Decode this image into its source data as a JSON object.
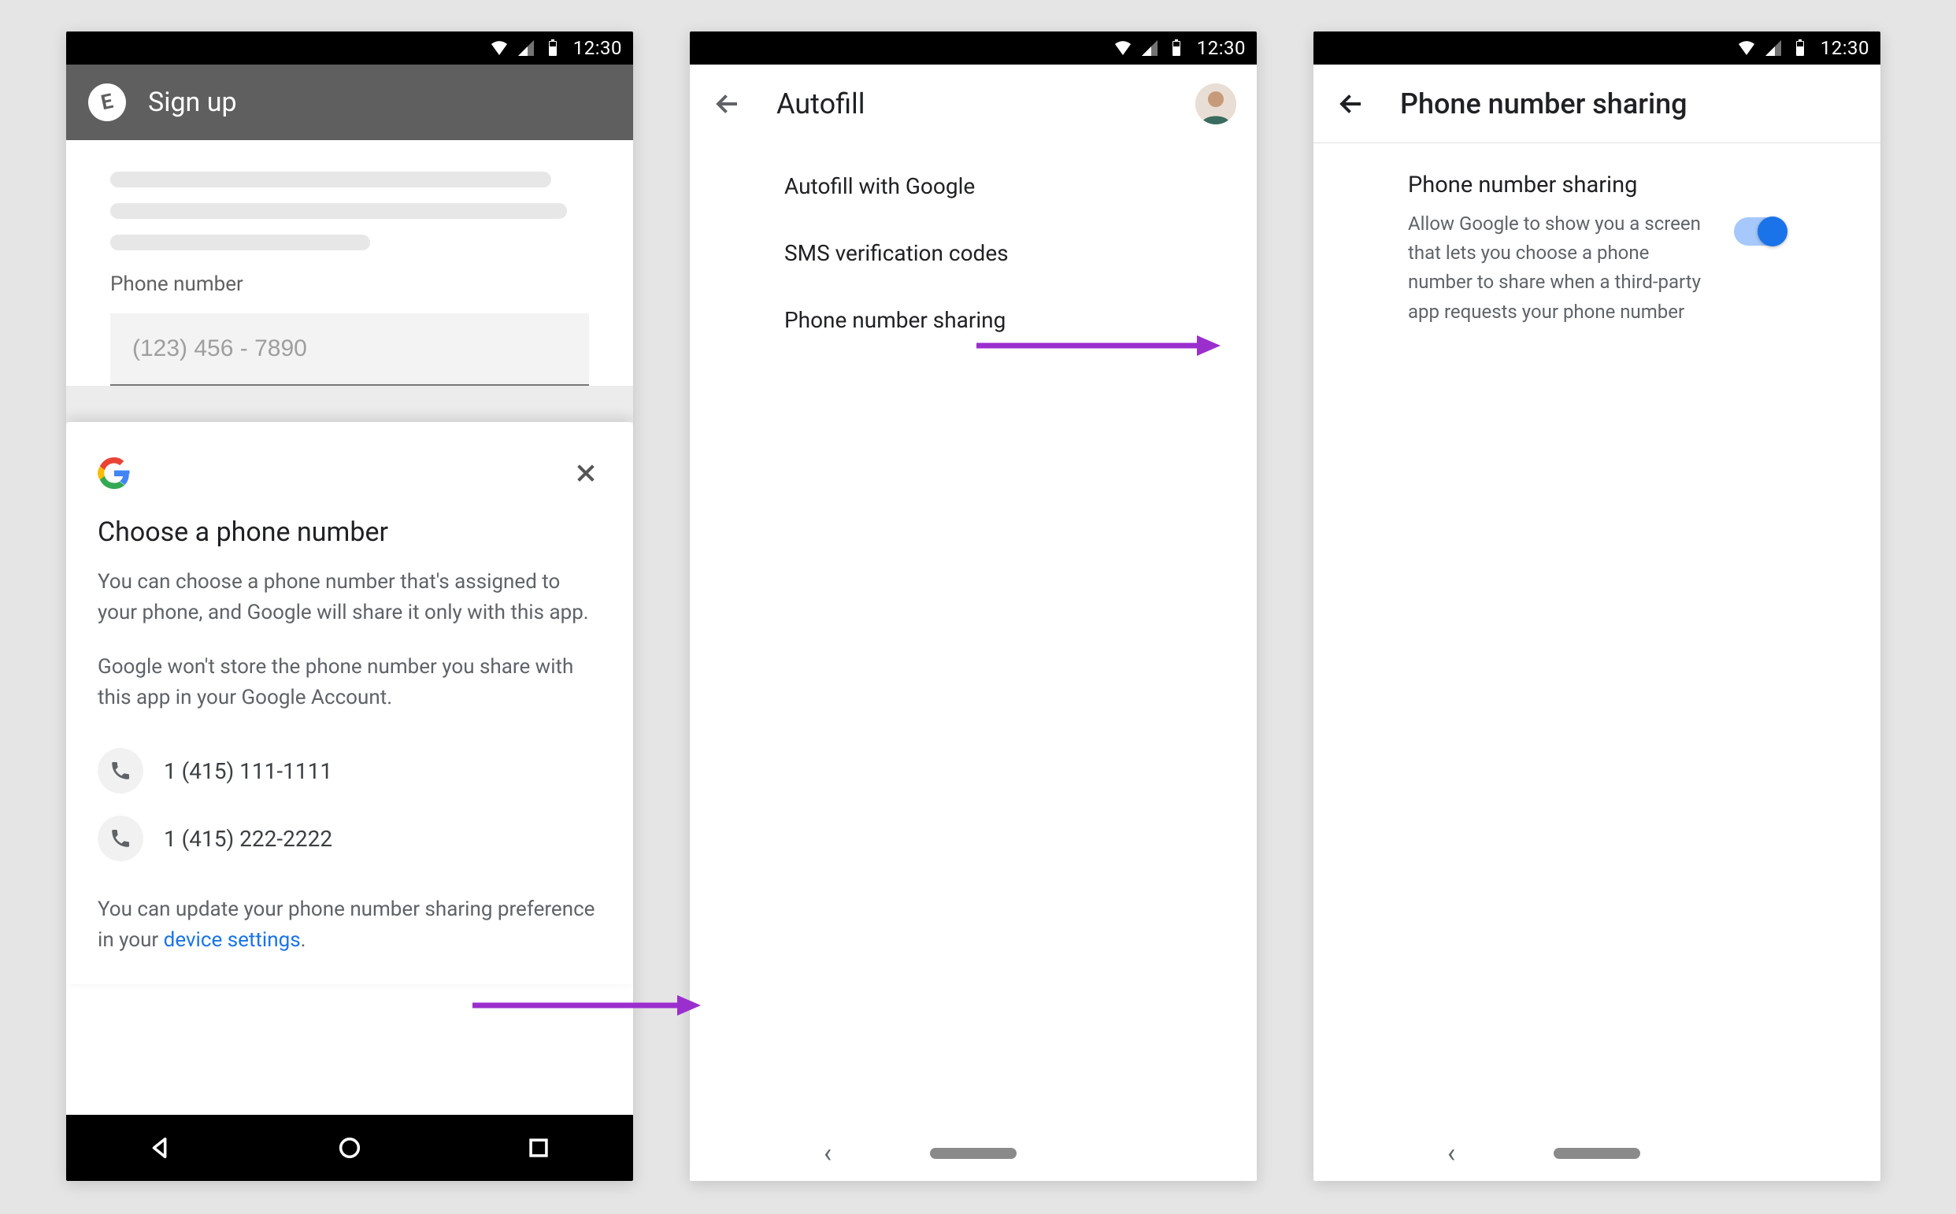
{
  "status": {
    "time": "12:30"
  },
  "phone1": {
    "app_logo_letter": "E",
    "header_title": "Sign up",
    "field_label": "Phone number",
    "input_placeholder": "(123) 456 - 7890",
    "sheet": {
      "title": "Choose a phone number",
      "para1": "You can choose a phone number that's assigned to your phone, and Google will share it only with this app.",
      "para2": "Google won't store the phone number you share with this app in your Google Account.",
      "numbers": [
        "1 (415) 111-1111",
        "1 (415) 222-2222"
      ],
      "footer_prefix": "You can update your phone number sharing preference in your ",
      "footer_link": "device settings",
      "footer_suffix": "."
    }
  },
  "phone2": {
    "title": "Autofill",
    "items": [
      "Autofill with Google",
      "SMS verification codes",
      "Phone number sharing"
    ]
  },
  "phone3": {
    "title": "Phone number sharing",
    "setting_title": "Phone number sharing",
    "setting_desc": "Allow Google to show you a screen that lets you choose a phone number to share when a third-party app requests your phone number",
    "switch_on": true
  },
  "colors": {
    "link": "#1a73e8",
    "arrow": "#9b2fce"
  }
}
